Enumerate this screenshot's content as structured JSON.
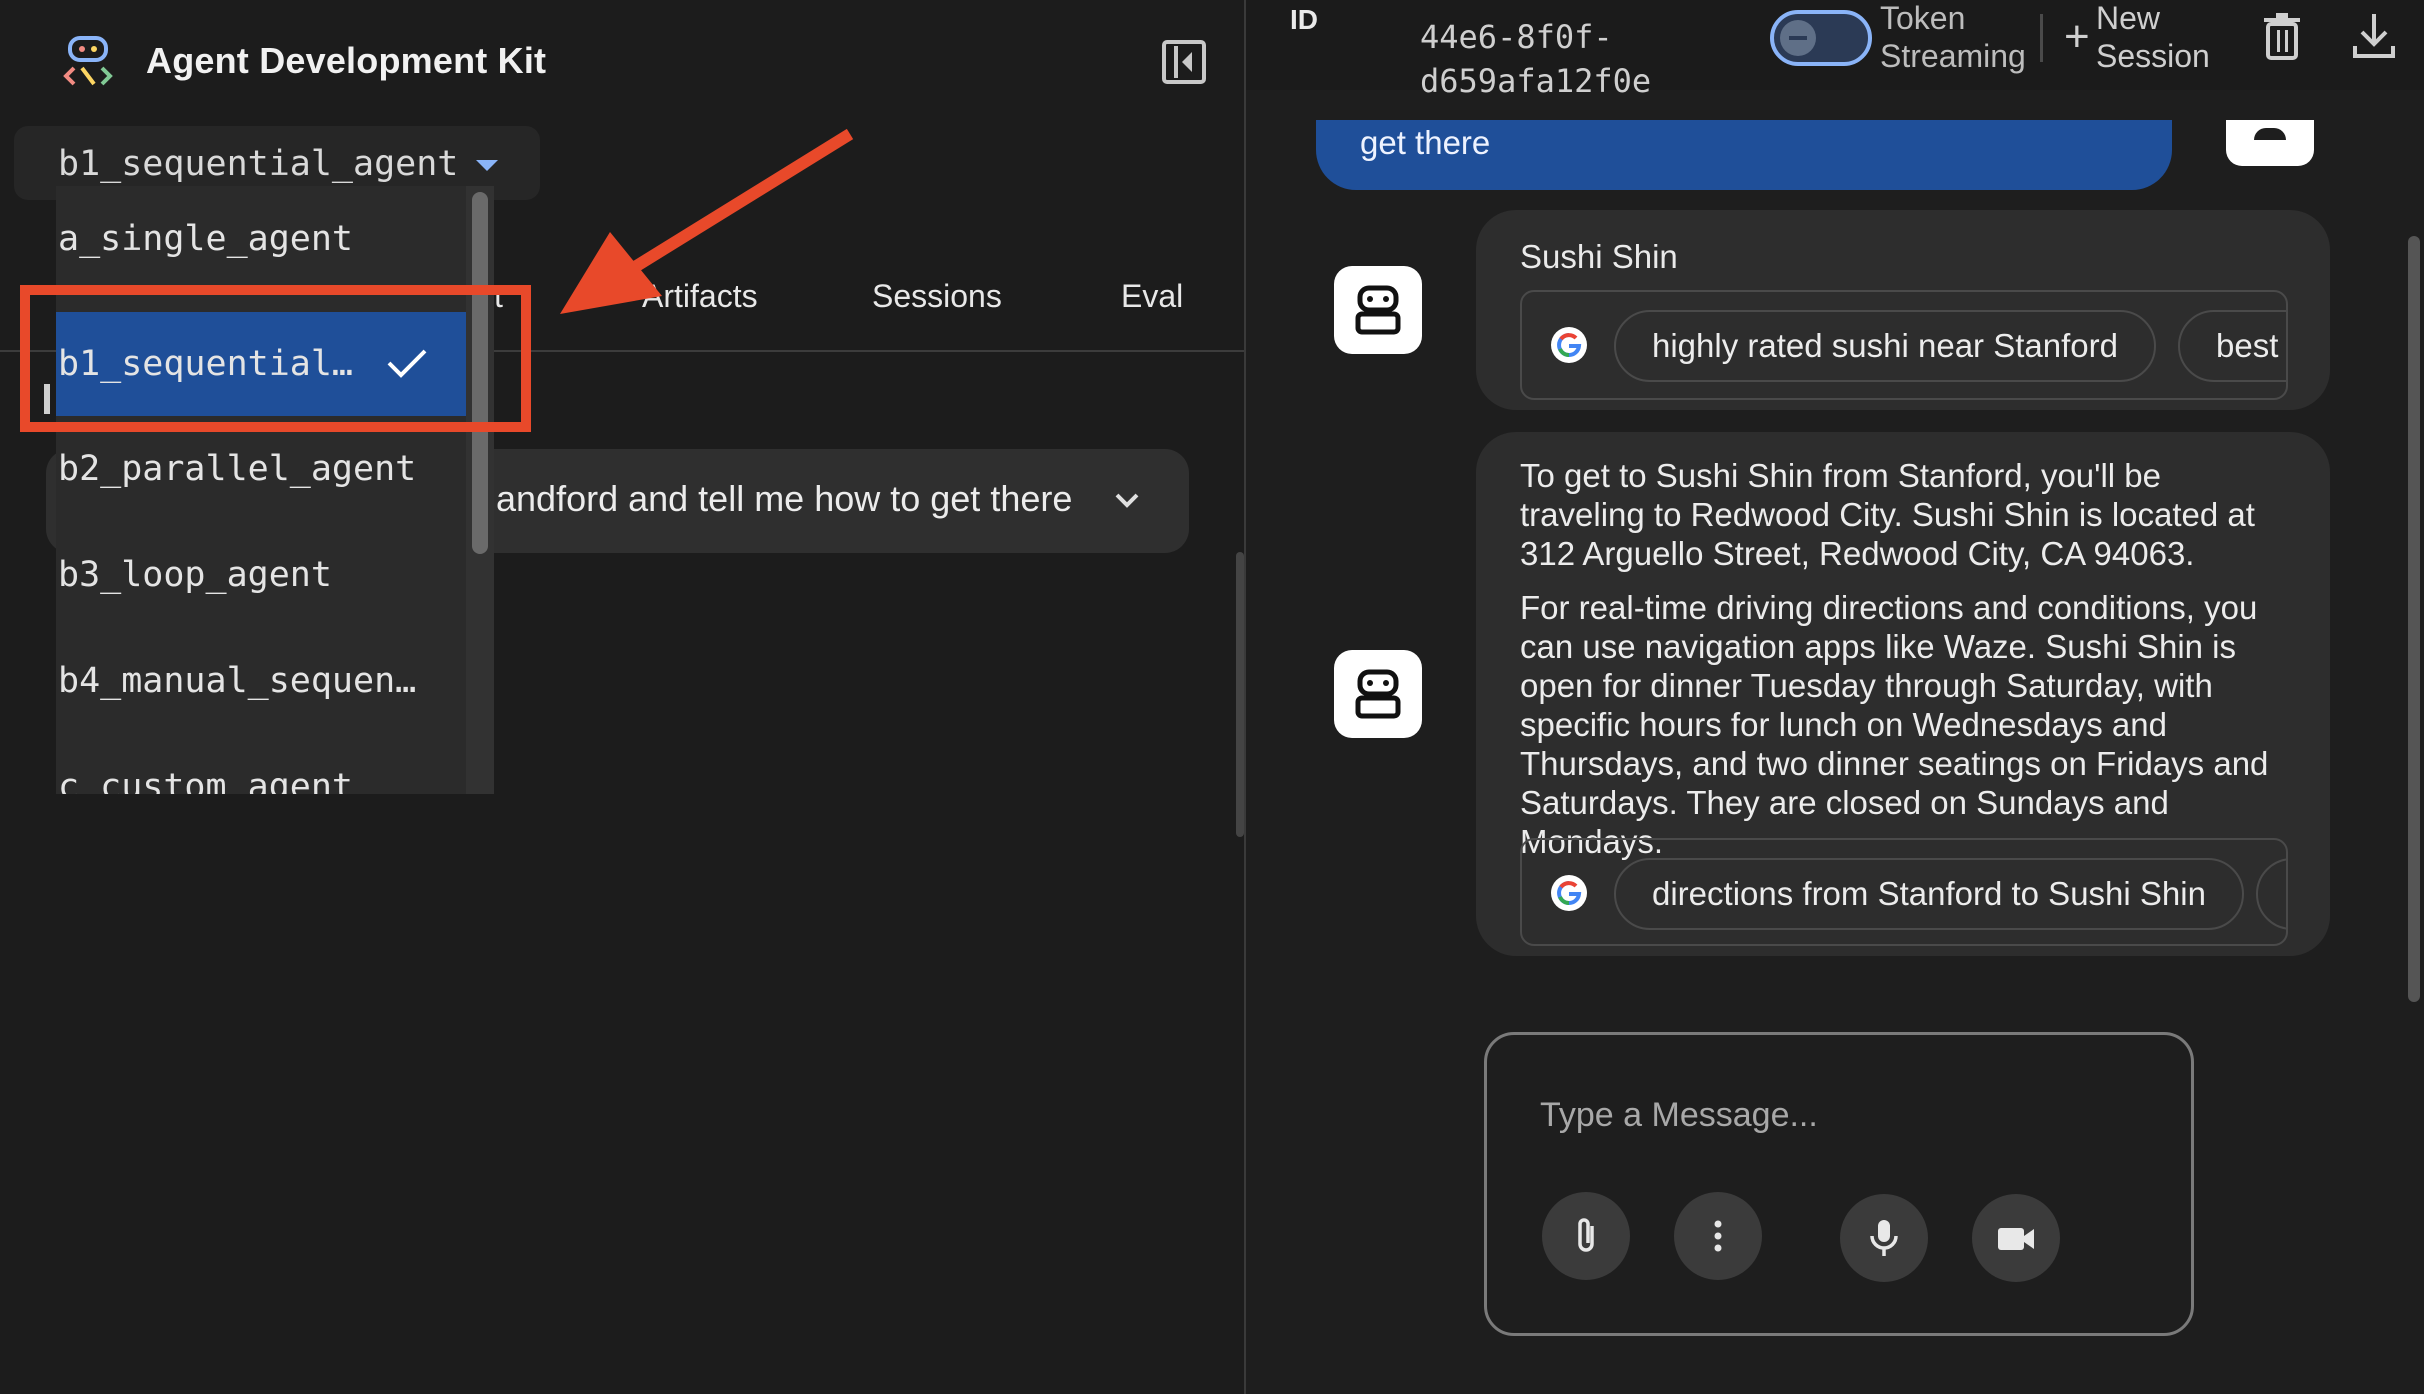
{
  "app": {
    "title": "Agent Development Kit"
  },
  "agent_select": {
    "value": "b1_sequential_agent",
    "options": [
      "a_single_agent",
      "b1_sequential…",
      "b2_parallel_agent",
      "b3_loop_agent",
      "b4_manual_sequen…",
      "c_custom_agent"
    ],
    "selected_index": 1
  },
  "tabs": {
    "partial": "t",
    "artifacts": "Artifacts",
    "sessions": "Sessions",
    "eval": "Eval"
  },
  "events": {
    "row_text": "andford and tell me how to get there"
  },
  "session": {
    "label": "ID",
    "id_line1": "44e6-8f0f-",
    "id_line2": "d659afa12f0e"
  },
  "toolbar": {
    "token_streaming_1": "Token",
    "token_streaming_2": "Streaming",
    "new_session_1": "New",
    "new_session_2": "Session",
    "new_session_plus": "+"
  },
  "chat": {
    "user_message_tail": "get there",
    "bot_1": {
      "title": "Sushi Shin",
      "chips": [
        "highly rated sushi near Stanford",
        "best sushi"
      ]
    },
    "bot_2": {
      "para1": "To get to Sushi Shin from Stanford, you'll be traveling to Redwood City. Sushi Shin is located at 312 Arguello Street, Redwood City, CA 94063.",
      "para2": "For real-time driving directions and conditions, you can use navigation apps like Waze. Sushi Shin is open for dinner Tuesday through Saturday, with specific hours for lunch on Wednesdays and Thursdays, and two dinner seatings on Fridays and Saturdays. They are closed on Sundays and Mondays.",
      "chips": [
        "directions from Stanford to Sushi Shin"
      ]
    }
  },
  "composer": {
    "placeholder": "Type a Message..."
  },
  "colors": {
    "accent": "#8ab4f8",
    "selected": "#1f4f99",
    "annotation": "#e8492a"
  }
}
